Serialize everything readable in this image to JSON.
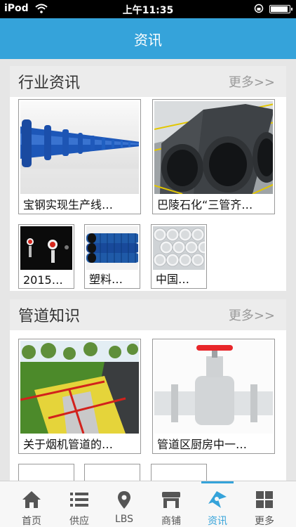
{
  "status_bar": {
    "carrier": "iPod",
    "time": "上午11:35"
  },
  "header": {
    "title": "资讯"
  },
  "sections": [
    {
      "title": "行业资讯",
      "more": "更多>>",
      "items": [
        {
          "caption": "宝钢实现生产线…",
          "image": "blue-pipeline"
        },
        {
          "caption": "巴陵石化“三管齐…",
          "image": "black-pipes"
        },
        {
          "caption": "2015…",
          "image": "dark-tunnel"
        },
        {
          "caption": "塑料…",
          "image": "corrugated-pipes"
        },
        {
          "caption": "中国…",
          "image": "white-pipes"
        }
      ]
    },
    {
      "title": "管道知识",
      "more": "更多>>",
      "items": [
        {
          "caption": "关于烟机管道的…",
          "image": "pipeline-trench"
        },
        {
          "caption": "管道区厨房中一…",
          "image": "red-valve"
        }
      ]
    }
  ],
  "tabs": [
    {
      "label": "首页",
      "icon": "home-icon",
      "active": false
    },
    {
      "label": "供应",
      "icon": "list-icon",
      "active": false
    },
    {
      "label": "LBS",
      "icon": "location-pin-icon",
      "active": false
    },
    {
      "label": "商铺",
      "icon": "shop-icon",
      "active": false
    },
    {
      "label": "资讯",
      "icon": "news-icon",
      "active": true
    },
    {
      "label": "更多",
      "icon": "grid-icon",
      "active": false
    }
  ],
  "colors": {
    "accent": "#35a3da",
    "valve_red": "#e8262a"
  }
}
